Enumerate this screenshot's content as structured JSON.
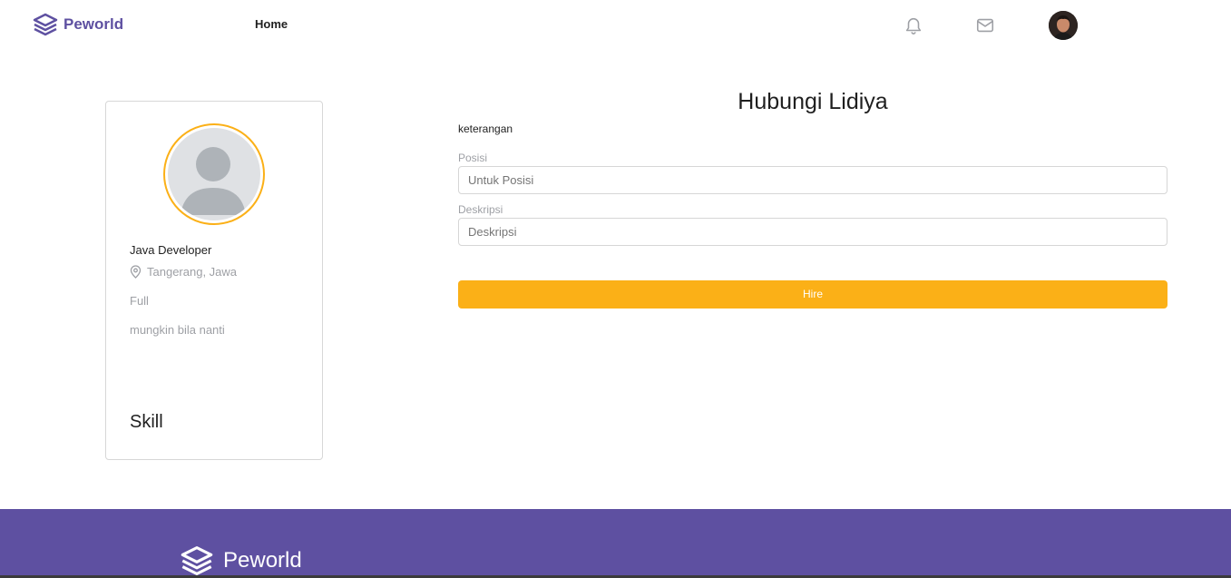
{
  "header": {
    "brand": "Peworld",
    "nav_home": "Home",
    "icons": [
      "bell-icon",
      "mail-icon"
    ]
  },
  "profile": {
    "job": "Java Developer",
    "location": "Tangerang, Jawa",
    "type": "Full",
    "description": "mungkin bila nanti",
    "skill_heading": "Skill"
  },
  "contact": {
    "title": "Hubungi Lidiya",
    "subtitle": "keterangan",
    "position_label": "Posisi",
    "position_placeholder": "Untuk Posisi",
    "description_label": "Deskripsi",
    "description_placeholder": "Deskripsi",
    "hire_button": "Hire"
  },
  "footer": {
    "brand": "Peworld"
  },
  "colors": {
    "brand": "#5e50a1",
    "accent": "#fbb017",
    "muted": "#9ea0a5"
  }
}
